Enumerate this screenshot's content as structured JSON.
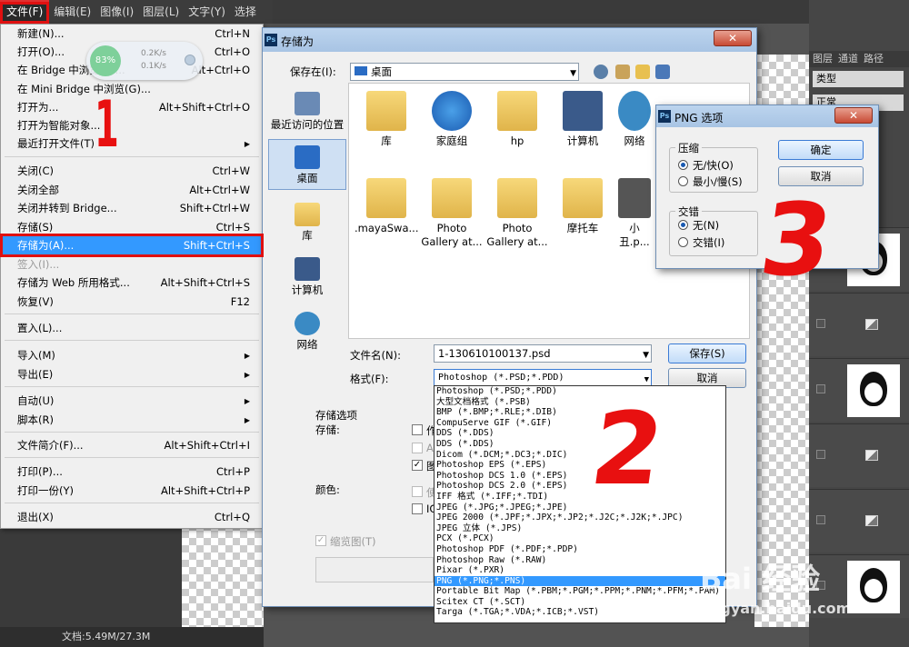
{
  "menubar": {
    "items": [
      "文件(F)",
      "编辑(E)",
      "图像(I)",
      "图层(L)",
      "文字(Y)",
      "选择"
    ]
  },
  "file_menu": {
    "items": [
      {
        "label": "新建(N)...",
        "shortcut": "Ctrl+N"
      },
      {
        "label": "打开(O)...",
        "shortcut": "Ctrl+O"
      },
      {
        "label": "在 Bridge 中浏览(B)...",
        "shortcut": "Alt+Ctrl+O"
      },
      {
        "label": "在 Mini Bridge 中浏览(G)...",
        "shortcut": ""
      },
      {
        "label": "打开为...",
        "shortcut": "Alt+Shift+Ctrl+O"
      },
      {
        "label": "打开为智能对象...",
        "shortcut": ""
      },
      {
        "label": "最近打开文件(T)",
        "shortcut": ""
      },
      {
        "label": "关闭(C)",
        "shortcut": "Ctrl+W"
      },
      {
        "label": "关闭全部",
        "shortcut": "Alt+Ctrl+W"
      },
      {
        "label": "关闭并转到 Bridge...",
        "shortcut": "Shift+Ctrl+W"
      },
      {
        "label": "存储(S)",
        "shortcut": "Ctrl+S"
      },
      {
        "label": "存储为(A)...",
        "shortcut": "Shift+Ctrl+S"
      },
      {
        "label": "签入(I)...",
        "shortcut": ""
      },
      {
        "label": "存储为 Web 所用格式...",
        "shortcut": "Alt+Shift+Ctrl+S"
      },
      {
        "label": "恢复(V)",
        "shortcut": "F12"
      },
      {
        "label": "置入(L)...",
        "shortcut": ""
      },
      {
        "label": "导入(M)",
        "shortcut": ""
      },
      {
        "label": "导出(E)",
        "shortcut": ""
      },
      {
        "label": "自动(U)",
        "shortcut": ""
      },
      {
        "label": "脚本(R)",
        "shortcut": ""
      },
      {
        "label": "文件简介(F)...",
        "shortcut": "Alt+Shift+Ctrl+I"
      },
      {
        "label": "打印(P)...",
        "shortcut": "Ctrl+P"
      },
      {
        "label": "打印一份(Y)",
        "shortcut": "Alt+Shift+Ctrl+P"
      },
      {
        "label": "退出(X)",
        "shortcut": "Ctrl+Q"
      }
    ]
  },
  "net_widget": {
    "percent": "83%",
    "up": "0.2K/s",
    "down": "0.1K/s"
  },
  "save_dialog": {
    "title": "存储为",
    "save_in_label": "保存在(I):",
    "save_in_value": "桌面",
    "places": [
      "最近访问的位置",
      "桌面",
      "库",
      "计算机",
      "网络"
    ],
    "files": [
      "库",
      "家庭组",
      "hp",
      "计算机",
      "网络",
      ".mayaSwa...",
      "Photo Gallery at...",
      "Photo Gallery at...",
      "摩托车",
      "小丑.p..."
    ],
    "filename_label": "文件名(N):",
    "filename_value": "1-130610100137.psd",
    "format_label": "格式(F):",
    "format_value": "Photoshop (*.PSD;*.PDD)",
    "save_button": "保存(S)",
    "cancel_button": "取消",
    "options_title": "存储选项",
    "options_save_label": "存储:",
    "opt_as_copy": "作",
    "opt_alpha": "A",
    "opt_layers": "图",
    "color_label": "颜色:",
    "opt_proof": "使",
    "opt_icc": "IC",
    "thumbnail_label": "缩览图(T)"
  },
  "format_options": [
    "Photoshop (*.PSD;*.PDD)",
    "大型文档格式 (*.PSB)",
    "BMP (*.BMP;*.RLE;*.DIB)",
    "CompuServe GIF (*.GIF)",
    "DDS  (*.DDS)",
    "DDS  (*.DDS)",
    "Dicom (*.DCM;*.DC3;*.DIC)",
    "Photoshop EPS (*.EPS)",
    "Photoshop DCS 1.0 (*.EPS)",
    "Photoshop DCS 2.0 (*.EPS)",
    "IFF 格式 (*.IFF;*.TDI)",
    "JPEG (*.JPG;*.JPEG;*.JPE)",
    "JPEG 2000 (*.JPF;*.JPX;*.JP2;*.J2C;*.J2K;*.JPC)",
    "JPEG 立体 (*.JPS)",
    "PCX (*.PCX)",
    "Photoshop PDF (*.PDF;*.PDP)",
    "Photoshop Raw (*.RAW)",
    "Pixar (*.PXR)",
    "PNG (*.PNG;*.PNS)",
    "Portable Bit Map (*.PBM;*.PGM;*.PPM;*.PNM;*.PFM;*.PAM)",
    "Scitex CT (*.SCT)",
    "Targa (*.TGA;*.VDA;*.ICB;*.VST)"
  ],
  "png_dialog": {
    "title": "PNG 选项",
    "compression_title": "压缩",
    "compression_options": [
      "无/快(O)",
      "最小/慢(S)"
    ],
    "interlace_title": "交错",
    "interlace_options": [
      "无(N)",
      "交错(I)"
    ],
    "ok_button": "确定",
    "cancel_button": "取消"
  },
  "right_panel": {
    "tabs": [
      "图层",
      "通道",
      "路径"
    ],
    "filter": "类型",
    "blend_mode": "正常"
  },
  "status": {
    "doc": "文档:5.49M/27.3M"
  },
  "annotations": {
    "step1": "1",
    "step2": "2",
    "step3": "3"
  },
  "watermark": {
    "brand": "Bai 经验",
    "url": "jingyan.baidu.com"
  },
  "colors": {
    "highlight": "#3399ff",
    "annotation": "#e01010"
  }
}
